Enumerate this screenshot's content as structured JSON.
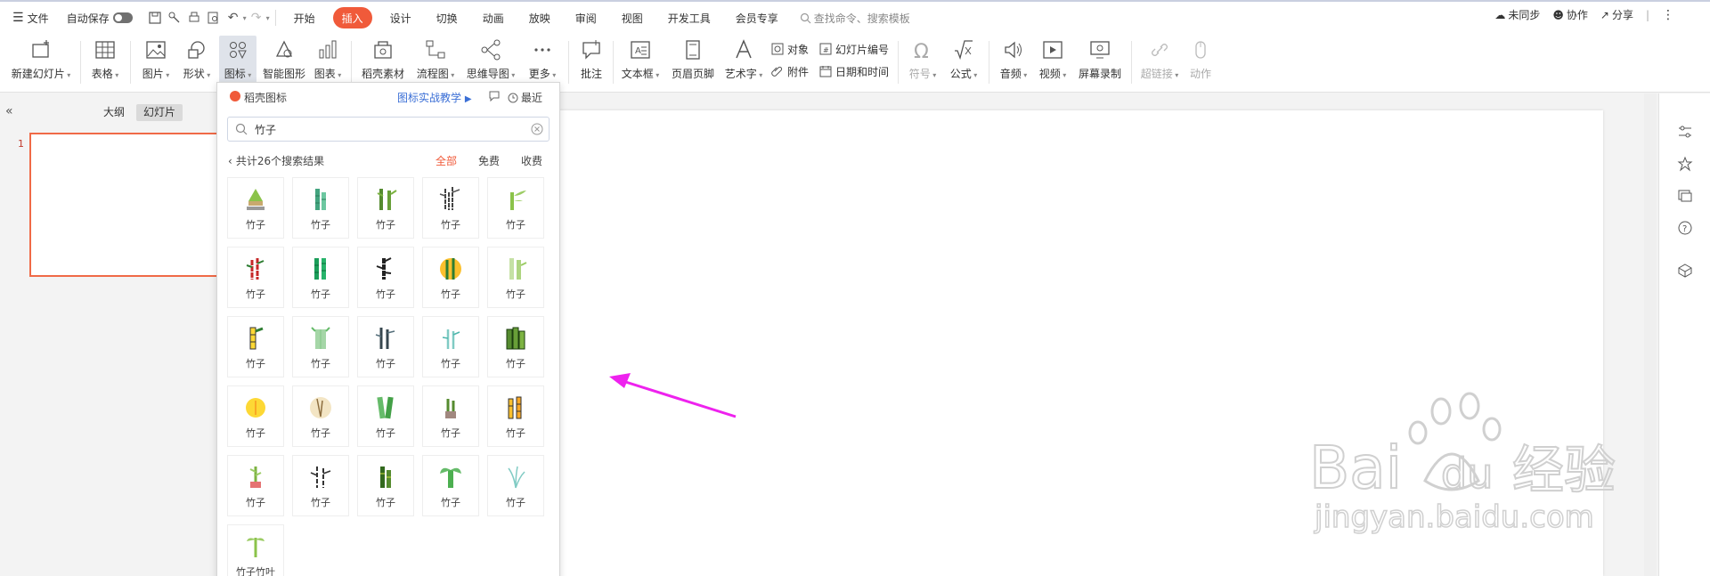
{
  "menubar": {
    "file": "文件",
    "autosave": "自动保存",
    "tabs": [
      "开始",
      "插入",
      "设计",
      "切换",
      "动画",
      "放映",
      "审阅",
      "视图",
      "开发工具",
      "会员专享"
    ],
    "active_tab": "插入",
    "search_placeholder": "查找命令、搜索模板",
    "sync": "未同步",
    "collab": "协作",
    "share": "分享"
  },
  "ribbon": {
    "new_slide": "新建幻灯片",
    "table": "表格",
    "picture": "图片",
    "shape": "形状",
    "icon": "图标",
    "smart_shape": "智能图形",
    "chart": "图表",
    "material": "稻壳素材",
    "flowchart": "流程图",
    "mindmap": "思维导图",
    "more": "更多",
    "comment": "批注",
    "textbox": "文本框",
    "header_footer": "页眉页脚",
    "wordart": "艺术字",
    "object": "对象",
    "attachment": "附件",
    "slide_number": "幻灯片编号",
    "datetime": "日期和时间",
    "symbol": "符号",
    "formula": "公式",
    "audio": "音频",
    "video": "视频",
    "screen_record": "屏幕录制",
    "hyperlink": "超链接",
    "action": "动作"
  },
  "leftpanel": {
    "outline_tab": "大纲",
    "slides_tab": "幻灯片",
    "slide_number": "1"
  },
  "popup": {
    "title": "稻壳图标",
    "teach_link": "图标实战教学",
    "recent": "最近",
    "search_value": "竹子",
    "result_text": "共计26个搜索结果",
    "filters": [
      "全部",
      "免费",
      "收费"
    ],
    "icons": [
      "竹子",
      "竹子",
      "竹子",
      "竹子",
      "竹子",
      "竹子",
      "竹子",
      "竹子",
      "竹子",
      "竹子",
      "竹子",
      "竹子",
      "竹子",
      "竹子",
      "竹子",
      "竹子",
      "竹子",
      "竹子",
      "竹子",
      "竹子",
      "竹子",
      "竹子",
      "竹子",
      "竹子",
      "竹子",
      "竹子竹叶"
    ]
  },
  "watermark": {
    "brand": "Bai",
    "brand_du": "du",
    "brand_cn": "经验",
    "url": "jingyan.baidu.com"
  },
  "colors": {
    "accent": "#f05a3a",
    "link": "#3b6fd6",
    "arrow": "#ee22ee",
    "bamboo_green": "#4caf50"
  }
}
